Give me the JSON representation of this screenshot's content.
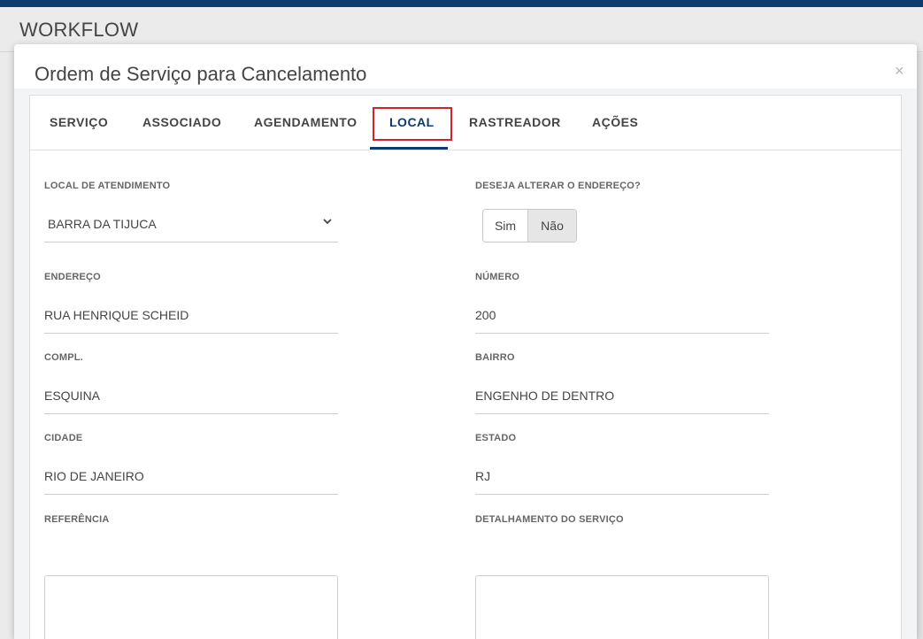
{
  "page": {
    "title": "WORKFLOW"
  },
  "modal": {
    "title": "Ordem de Serviço para Cancelamento",
    "close_icon": "close-icon",
    "close_glyph": "×"
  },
  "tabs": [
    {
      "label": "SERVIÇO",
      "active": false
    },
    {
      "label": "ASSOCIADO",
      "active": false
    },
    {
      "label": "AGENDAMENTO",
      "active": false
    },
    {
      "label": "LOCAL",
      "active": true
    },
    {
      "label": "RASTREADOR",
      "active": false
    },
    {
      "label": "AÇÕES",
      "active": false
    }
  ],
  "form": {
    "local_atendimento": {
      "label": "LOCAL DE ATENDIMENTO",
      "value": "BARRA DA TIJUCA"
    },
    "alterar_endereco": {
      "label": "DESEJA ALTERAR O ENDEREÇO?",
      "options": [
        "Sim",
        "Não"
      ],
      "selected": "Não"
    },
    "endereco": {
      "label": "ENDEREÇO",
      "value": "RUA HENRIQUE SCHEID"
    },
    "numero": {
      "label": "NÚMERO",
      "value": "200"
    },
    "compl": {
      "label": "COMPL.",
      "value": "ESQUINA"
    },
    "bairro": {
      "label": "BAIRRO",
      "value": "ENGENHO DE DENTRO"
    },
    "cidade": {
      "label": "CIDADE",
      "value": "RIO DE JANEIRO"
    },
    "estado": {
      "label": "ESTADO",
      "value": "RJ"
    },
    "referencia": {
      "label": "REFERÊNCIA",
      "value": ""
    },
    "detalhamento": {
      "label": "DETALHAMENTO DO SERVIÇO",
      "value": ""
    }
  },
  "colors": {
    "brand": "#0f3a6e",
    "highlight": "#d6202b",
    "toggle_selected": "#e6e6e6"
  }
}
